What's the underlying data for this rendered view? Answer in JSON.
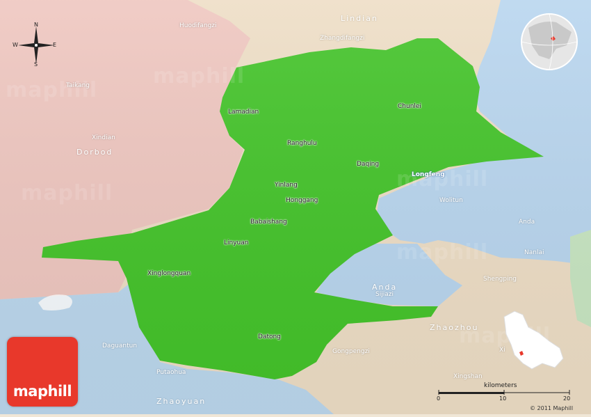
{
  "compass": {
    "n": "N",
    "s": "S",
    "e": "E",
    "w": "W"
  },
  "cities": {
    "lamadian": "Lamadian",
    "chunlei": "Chunlei",
    "ranghulu": "Ranghulu",
    "daqing": "Daqing",
    "longfeng": "Longfeng",
    "yinlang": "Yinlang",
    "honggang": "Honggang",
    "babaishang": "Babaishang",
    "linyuan": "Linyuan",
    "xinglongquan": "Xinglongquan",
    "datong": "Datong"
  },
  "towns": {
    "huodifangzi": "Huodifangzi",
    "zhangdifangzi": "Zhangdifangzi",
    "taikang": "Taikang",
    "xindian": "Xindian",
    "wolitun": "Wolitun",
    "anda_town": "Anda",
    "nanlai": "Nanlai",
    "shengping": "Shengping",
    "sijiazi": "Sijiazi",
    "daguantun": "Daguantun",
    "putaohua": "Putaohua",
    "gongpengzi": "Gongpengzi",
    "xingshan": "Xingshan",
    "xi_partial": "Xi"
  },
  "regions": {
    "lindian": "Lindian",
    "dorbod": "Dorbod",
    "anda": "Anda",
    "zhaozhou": "Zhaozhou",
    "zhaoyuan": "Zhaoyuan"
  },
  "watermark": "maphill",
  "logo": "maphill",
  "scale": {
    "title": "kilometers",
    "min": "0",
    "mid": "10",
    "max": "20"
  },
  "copyright": "© 2011 Maphill",
  "colors": {
    "selected_region": "#44c42a",
    "dorbod": "#efc7c0",
    "lindian_zhaozhou": "#eedec6",
    "anda_water_blue": "#b8d6ef",
    "logo_red": "#e8382b"
  }
}
